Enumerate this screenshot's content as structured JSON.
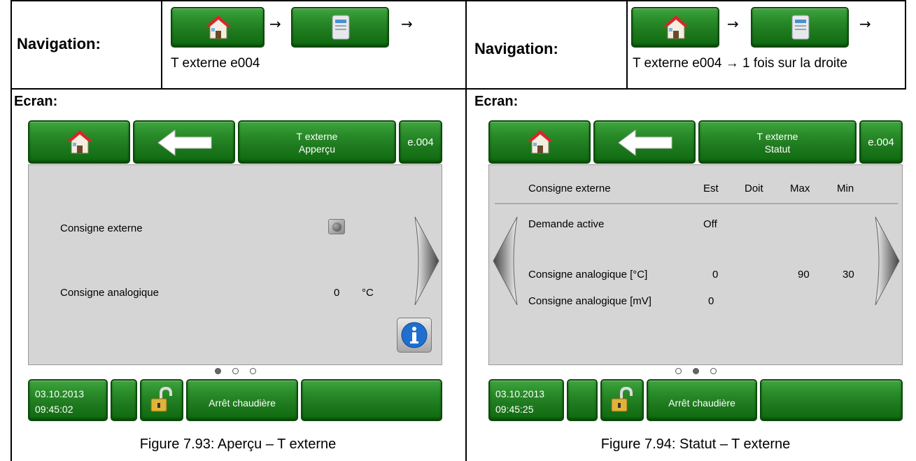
{
  "navigation_label": "Navigation:",
  "arrow": "→",
  "left": {
    "nav_path": "T externe e004",
    "ecran_label": "Ecran:",
    "screen": {
      "title_line1": "T externe",
      "title_line2": "Apperçu",
      "code": "e.004",
      "rows": [
        {
          "label": "Consigne externe",
          "value": "",
          "unit": ""
        },
        {
          "label": "Consigne analogique",
          "value": "0",
          "unit": "°C"
        }
      ],
      "page_dots": [
        true,
        false,
        false
      ],
      "date": "03.10.2013",
      "time": "09:45:02",
      "status": "Arrêt chaudière"
    },
    "caption": "Figure 7.93: Aperçu – T externe"
  },
  "right": {
    "nav_path": "T externe e004 → 1 fois sur la droite",
    "ecran_label": "Ecran:",
    "screen": {
      "title_line1": "T externe",
      "title_line2": "Statut",
      "code": "e.004",
      "headers": {
        "name": "Consigne externe",
        "est": "Est",
        "doit": "Doit",
        "max": "Max",
        "min": "Min"
      },
      "rows": [
        {
          "label": "Demande active",
          "est": "Off",
          "doit": "",
          "max": "",
          "min": ""
        },
        {
          "label": "Consigne analogique [°C]",
          "est": "0",
          "doit": "",
          "max": "90",
          "min": "30"
        },
        {
          "label": "Consigne analogique [mV]",
          "est": "0",
          "doit": "",
          "max": "",
          "min": ""
        }
      ],
      "page_dots": [
        false,
        true,
        false
      ],
      "date": "03.10.2013",
      "time": "09:45:25",
      "status": "Arrêt chaudière"
    },
    "caption": "Figure 7.94: Statut – T externe"
  },
  "icons": {
    "home": "home-icon",
    "back": "back-arrow-icon",
    "boiler": "boiler-icon",
    "lock": "padlock-open-icon",
    "info": "info-icon",
    "next": "next-arrow-icon",
    "prev": "prev-arrow-icon"
  }
}
